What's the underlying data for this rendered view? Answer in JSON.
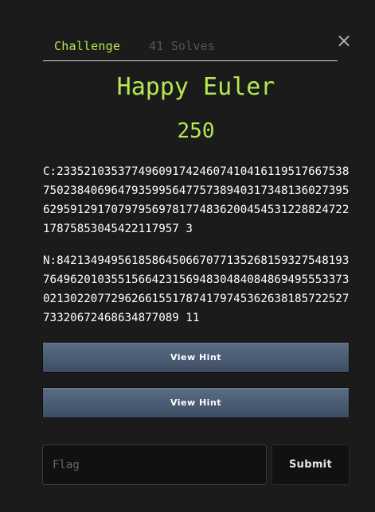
{
  "tabs": {
    "challenge": "Challenge",
    "solves": "41 Solves"
  },
  "close_icon": "×",
  "challenge": {
    "name": "Happy Euler",
    "value": "250",
    "description": {
      "c": "C:233521035377496091742460741041611951766753875023840696479359956477573894031734813602739562959129170797956978177483620045453122882472217875853045422117957 3",
      "n": "N:842134949561858645066707713526815932754819376496201035515664231569483048408486949555337302130220772962661551787417974536263818572252773320672468634877089 11"
    },
    "hints": [
      {
        "label": "View Hint"
      },
      {
        "label": "View Hint"
      }
    ],
    "flag_input": {
      "placeholder": "Flag",
      "value": ""
    },
    "submit_label": "Submit"
  },
  "colors": {
    "accent": "#b5e853",
    "background": "#1b1b1b",
    "hint_button": "#4a5b72"
  }
}
